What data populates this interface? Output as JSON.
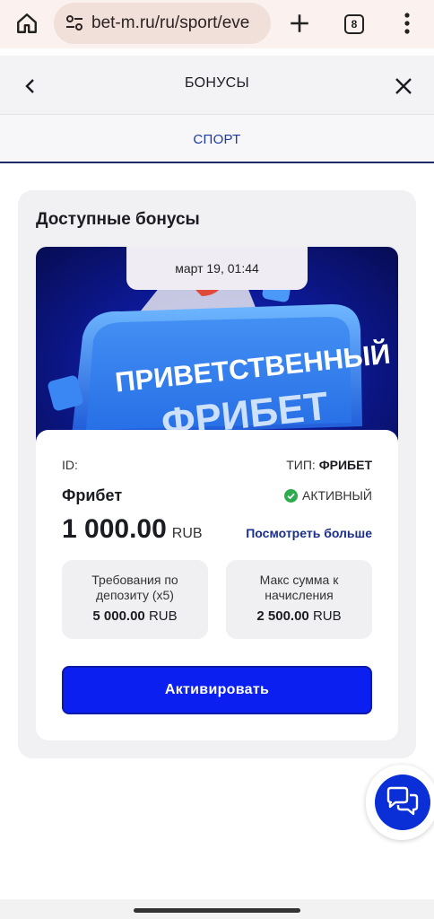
{
  "browser": {
    "url": "bet-m.ru/ru/sport/eve",
    "tab_count": "8",
    "icons": [
      "home-icon",
      "site-settings-icon",
      "plus-icon",
      "tabs-icon",
      "more-vert-icon"
    ]
  },
  "header": {
    "title": "БОНУСЫ",
    "back_icon": "chevron-left-icon",
    "close_icon": "close-icon"
  },
  "tabs": [
    {
      "label": "СПОРТ",
      "active": true
    }
  ],
  "bonuses": {
    "title": "Доступные бонусы",
    "banner": {
      "date": "март 19, 01:44",
      "art_text_line1": "ПРИВЕТСТВЕННЫЙ",
      "art_text_line2": "ФРИБЕТ"
    },
    "card": {
      "id_label": "ID:",
      "type_label": "ТИП:",
      "type_value": "ФРИБЕТ",
      "name": "Фрибет",
      "status": "АКТИВНЫЙ",
      "amount": "1 000.00",
      "currency": "RUB",
      "see_more": "Посмотреть больше",
      "requirement": {
        "label": "Требования по депозиту (x5)",
        "value": "5 000.00",
        "currency": "RUB"
      },
      "max_sum": {
        "label": "Макс сумма к начисления",
        "value": "2 500.00",
        "currency": "RUB"
      },
      "activate_label": "Активировать"
    }
  },
  "colors": {
    "accent": "#0a1ff0",
    "link": "#1a2f8a",
    "status_green": "#2eaa4f",
    "tab_active": "#1c3aa0"
  }
}
